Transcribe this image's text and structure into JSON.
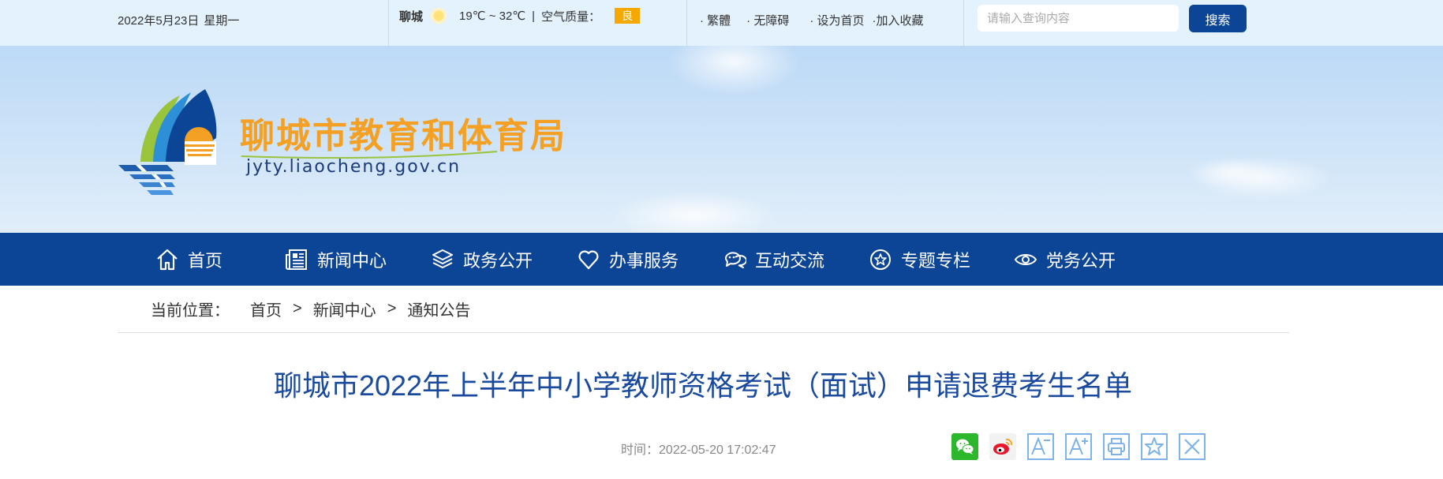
{
  "topbar": {
    "date": "2022年5月23日",
    "weekday": "星期一",
    "weather": {
      "city": "聊城",
      "icon": "sun-icon",
      "temperature": "19℃ ~ 32℃",
      "separator": "|",
      "air_quality_label": "空气质量：",
      "air_quality_value": "良"
    },
    "links": [
      "· 繁體",
      "· 无障碍",
      "· 设为首页",
      "·加入收藏"
    ],
    "search": {
      "placeholder": "请输入查询内容",
      "button": "搜索"
    }
  },
  "banner": {
    "site_name": "聊城市教育和体育局",
    "site_url": "jyty.liaocheng.gov.cn"
  },
  "nav": {
    "items": [
      {
        "label": "首页",
        "icon": "home-icon"
      },
      {
        "label": "新闻中心",
        "icon": "newspaper-icon"
      },
      {
        "label": "政务公开",
        "icon": "layers-icon"
      },
      {
        "label": "办事服务",
        "icon": "heart-icon"
      },
      {
        "label": "互动交流",
        "icon": "chat-icon"
      },
      {
        "label": "专题专栏",
        "icon": "star-badge-icon"
      },
      {
        "label": "党务公开",
        "icon": "eye-icon"
      }
    ]
  },
  "breadcrumb": {
    "label": "当前位置：",
    "items": [
      "首页",
      "新闻中心",
      "通知公告"
    ],
    "separator": ">"
  },
  "article": {
    "title": "聊城市2022年上半年中小学教师资格考试（面试）申请退费考生名单",
    "time_label": "时间：",
    "time_value": "2022-05-20 17:02:47"
  },
  "tools": [
    "wechat-share-icon",
    "weibo-share-icon",
    "font-decrease-icon",
    "font-increase-icon",
    "print-icon",
    "favorite-icon",
    "close-icon"
  ],
  "colors": {
    "primary": "#0d4596",
    "accent": "#f4a024",
    "title": "#1a4a9e"
  }
}
